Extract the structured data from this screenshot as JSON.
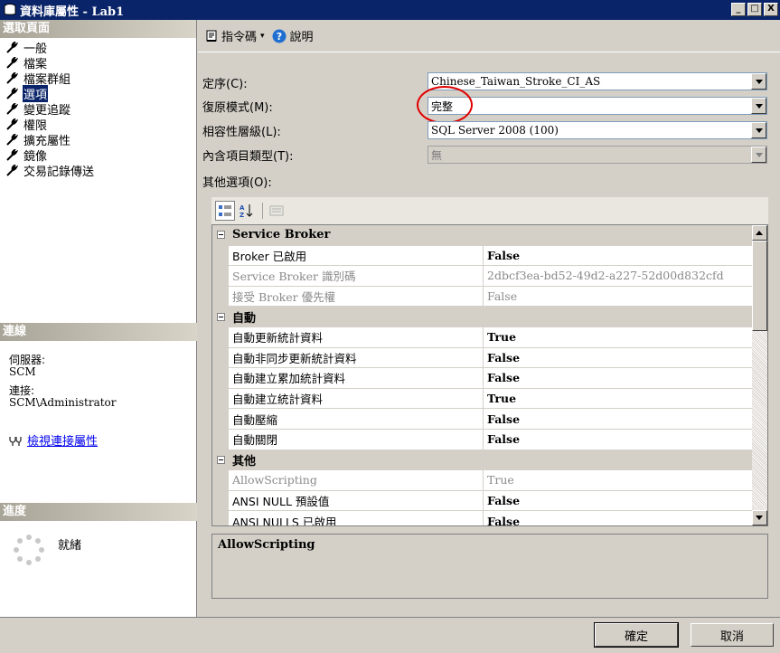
{
  "window": {
    "title": "資料庫屬性 - Lab1",
    "controls": [
      "_",
      "□",
      "X"
    ]
  },
  "sidebar": {
    "select_page_header": "選取頁面",
    "items": [
      {
        "label": "一般",
        "selected": false
      },
      {
        "label": "檔案",
        "selected": false
      },
      {
        "label": "檔案群組",
        "selected": false
      },
      {
        "label": "選項",
        "selected": true
      },
      {
        "label": "變更追蹤",
        "selected": false
      },
      {
        "label": "權限",
        "selected": false
      },
      {
        "label": "擴充屬性",
        "selected": false
      },
      {
        "label": "鏡像",
        "selected": false
      },
      {
        "label": "交易記錄傳送",
        "selected": false
      }
    ],
    "connection_header": "連線",
    "server_label": "伺服器:",
    "server_value": "SCM",
    "connection_label": "連接:",
    "connection_value": "SCM\\Administrator",
    "view_connection_link": "檢視連接屬性",
    "progress_header": "進度",
    "progress_status": "就緒"
  },
  "toolbar": {
    "script_label": "指令碼",
    "help_label": "說明"
  },
  "fields": {
    "collation_label": "定序(C):",
    "collation_value": "Chinese_Taiwan_Stroke_CI_AS",
    "recovery_label": "復原模式(M):",
    "recovery_value": "完整",
    "compat_label": "相容性層級(L):",
    "compat_value": "SQL Server 2008 (100)",
    "containment_label": "內含項目類型(T):",
    "containment_value": "無",
    "other_options_label": "其他選項(O):"
  },
  "grid": {
    "rows": [
      {
        "type": "category",
        "name": "Service Broker"
      },
      {
        "type": "prop",
        "name": "Broker 已啟用",
        "value": "False",
        "bold": true,
        "readonly": false
      },
      {
        "type": "prop",
        "name": "Service Broker 識別碼",
        "value": "2dbcf3ea-bd52-49d2-a227-52d00d832cfd",
        "bold": false,
        "readonly": true
      },
      {
        "type": "prop",
        "name": "接受 Broker 優先權",
        "value": "False",
        "bold": false,
        "readonly": true
      },
      {
        "type": "category",
        "name": "自動"
      },
      {
        "type": "prop",
        "name": "自動更新統計資料",
        "value": "True",
        "bold": true,
        "readonly": false
      },
      {
        "type": "prop",
        "name": "自動非同步更新統計資料",
        "value": "False",
        "bold": true,
        "readonly": false
      },
      {
        "type": "prop",
        "name": "自動建立累加統計資料",
        "value": "False",
        "bold": true,
        "readonly": false
      },
      {
        "type": "prop",
        "name": "自動建立統計資料",
        "value": "True",
        "bold": true,
        "readonly": false
      },
      {
        "type": "prop",
        "name": "自動壓縮",
        "value": "False",
        "bold": true,
        "readonly": false
      },
      {
        "type": "prop",
        "name": "自動關閉",
        "value": "False",
        "bold": true,
        "readonly": false
      },
      {
        "type": "category",
        "name": "其他"
      },
      {
        "type": "prop",
        "name": "AllowScripting",
        "value": "True",
        "bold": false,
        "readonly": true
      },
      {
        "type": "prop",
        "name": "ANSI NULL 預設值",
        "value": "False",
        "bold": true,
        "readonly": false
      },
      {
        "type": "prop",
        "name": "ANSI NULLS 已啟用",
        "value": "False",
        "bold": true,
        "readonly": false
      }
    ]
  },
  "description": {
    "title": "AllowScripting"
  },
  "buttons": {
    "ok": "確定",
    "cancel": "取消"
  },
  "colors": {
    "titlebar": "#0a246a",
    "highlight_circle": "#e00000",
    "link": "#0000ee"
  }
}
